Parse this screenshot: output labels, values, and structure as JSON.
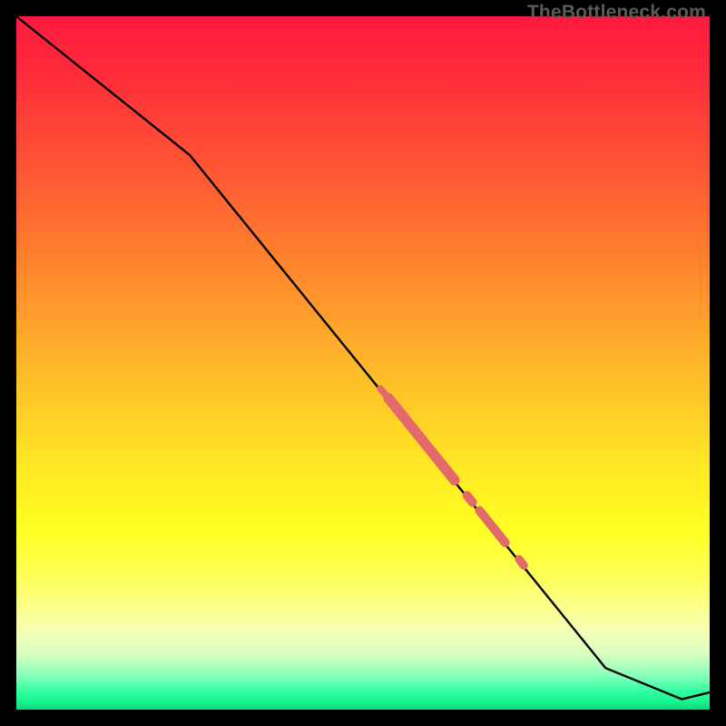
{
  "watermark": "TheBottleneck.com",
  "colors": {
    "curve": "#000000",
    "highlight": "#e26a6a"
  },
  "chart_data": {
    "type": "line",
    "title": "",
    "xlabel": "",
    "ylabel": "",
    "xlim": [
      0,
      100
    ],
    "ylim": [
      0,
      100
    ],
    "curve": {
      "x": [
        0,
        25,
        85,
        96,
        100
      ],
      "y": [
        100,
        80,
        6,
        1.5,
        2.5
      ]
    },
    "highlight_segments": [
      {
        "x": [
          52.5,
          53.7
        ],
        "y": [
          46.3,
          44.9
        ],
        "width_pct": 1.0
      },
      {
        "x": [
          53.7,
          63.2
        ],
        "y": [
          44.9,
          33.1
        ],
        "width_pct": 1.5
      },
      {
        "x": [
          65.0,
          65.8
        ],
        "y": [
          30.9,
          29.9
        ],
        "width_pct": 1.3
      },
      {
        "x": [
          66.8,
          70.5
        ],
        "y": [
          28.7,
          24.1
        ],
        "width_pct": 1.3
      },
      {
        "x": [
          72.5,
          73.2
        ],
        "y": [
          21.7,
          20.8
        ],
        "width_pct": 1.2
      }
    ]
  }
}
